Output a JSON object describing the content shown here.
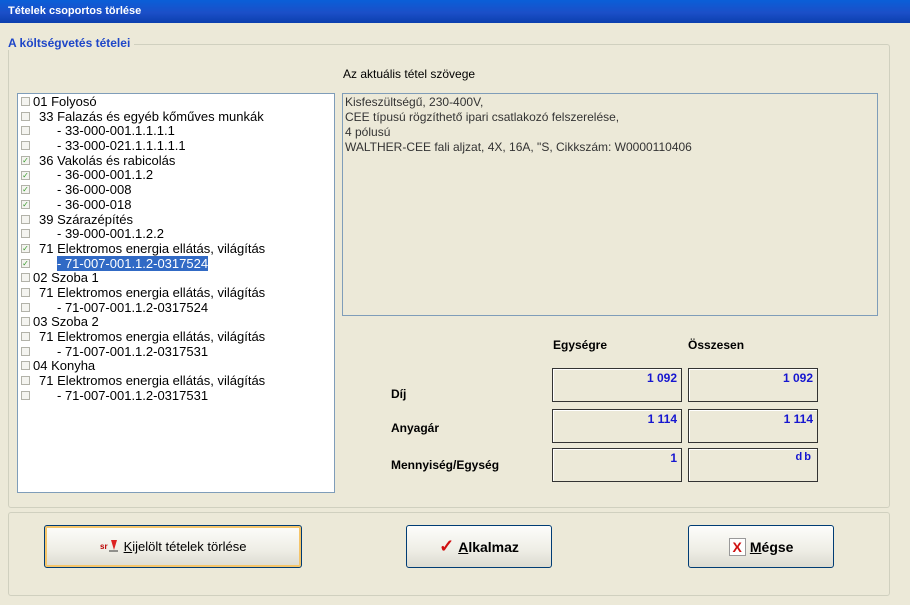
{
  "window": {
    "title": "Tételek csoportos törlése"
  },
  "group": {
    "title": "A költségvetés tételei"
  },
  "tree": [
    {
      "label": "01 Folyosó",
      "checked": false,
      "indent": 0
    },
    {
      "label": "33 Falazás és egyéb kőműves munkák",
      "checked": false,
      "indent": 1
    },
    {
      "label": "- 33-000-001.1.1.1.1",
      "checked": false,
      "indent": 2
    },
    {
      "label": "- 33-000-021.1.1.1.1.1",
      "checked": false,
      "indent": 2
    },
    {
      "label": "36 Vakolás és rabicolás",
      "checked": true,
      "indent": 1
    },
    {
      "label": "- 36-000-001.1.2",
      "checked": true,
      "indent": 2
    },
    {
      "label": "- 36-000-008",
      "checked": true,
      "indent": 2
    },
    {
      "label": "- 36-000-018",
      "checked": true,
      "indent": 2
    },
    {
      "label": "39 Szárazépítés",
      "checked": false,
      "indent": 1
    },
    {
      "label": "- 39-000-001.1.2.2",
      "checked": false,
      "indent": 2
    },
    {
      "label": "71 Elektromos energia ellátás, világítás",
      "checked": true,
      "indent": 1
    },
    {
      "label": "- 71-007-001.1.2-0317524",
      "checked": true,
      "indent": 2,
      "selected": true
    },
    {
      "label": "02 Szoba 1",
      "checked": false,
      "indent": 0
    },
    {
      "label": "71 Elektromos energia ellátás, világítás",
      "checked": false,
      "indent": 1
    },
    {
      "label": "- 71-007-001.1.2-0317524",
      "checked": false,
      "indent": 2
    },
    {
      "label": "03 Szoba 2",
      "checked": false,
      "indent": 0
    },
    {
      "label": "71 Elektromos energia ellátás, világítás",
      "checked": false,
      "indent": 1
    },
    {
      "label": "- 71-007-001.1.2-0317531",
      "checked": false,
      "indent": 2
    },
    {
      "label": "04 Konyha",
      "checked": false,
      "indent": 0
    },
    {
      "label": "71 Elektromos energia ellátás, világítás",
      "checked": false,
      "indent": 1
    },
    {
      "label": "- 71-007-001.1.2-0317531",
      "checked": false,
      "indent": 2
    }
  ],
  "detail": {
    "heading": "Az aktuális tétel szövege",
    "lines": [
      "Kisfeszültségű, 230-400V,",
      "CEE típusú rögzíthető ipari csatlakozó felszerelése,",
      "4 pólusú",
      "WALTHER-CEE fali aljzat, 4X, 16A, \"S, Cikkszám: W0000110406"
    ]
  },
  "prices": {
    "col_unit": "Egységre",
    "col_total": "Összesen",
    "dij_label": "Díj",
    "dij_unit": "1 092",
    "dij_total": "1 092",
    "anyag_label": "Anyagár",
    "anyag_unit": "1 114",
    "anyag_total": "1 114",
    "menny_label": "Mennyiség/Egység",
    "menny_value": "1",
    "menny_unit": "db"
  },
  "buttons": {
    "delete_label": "Kijelölt tételek törlése",
    "apply_label": "Alkalmaz",
    "cancel_label": "Mégse"
  }
}
